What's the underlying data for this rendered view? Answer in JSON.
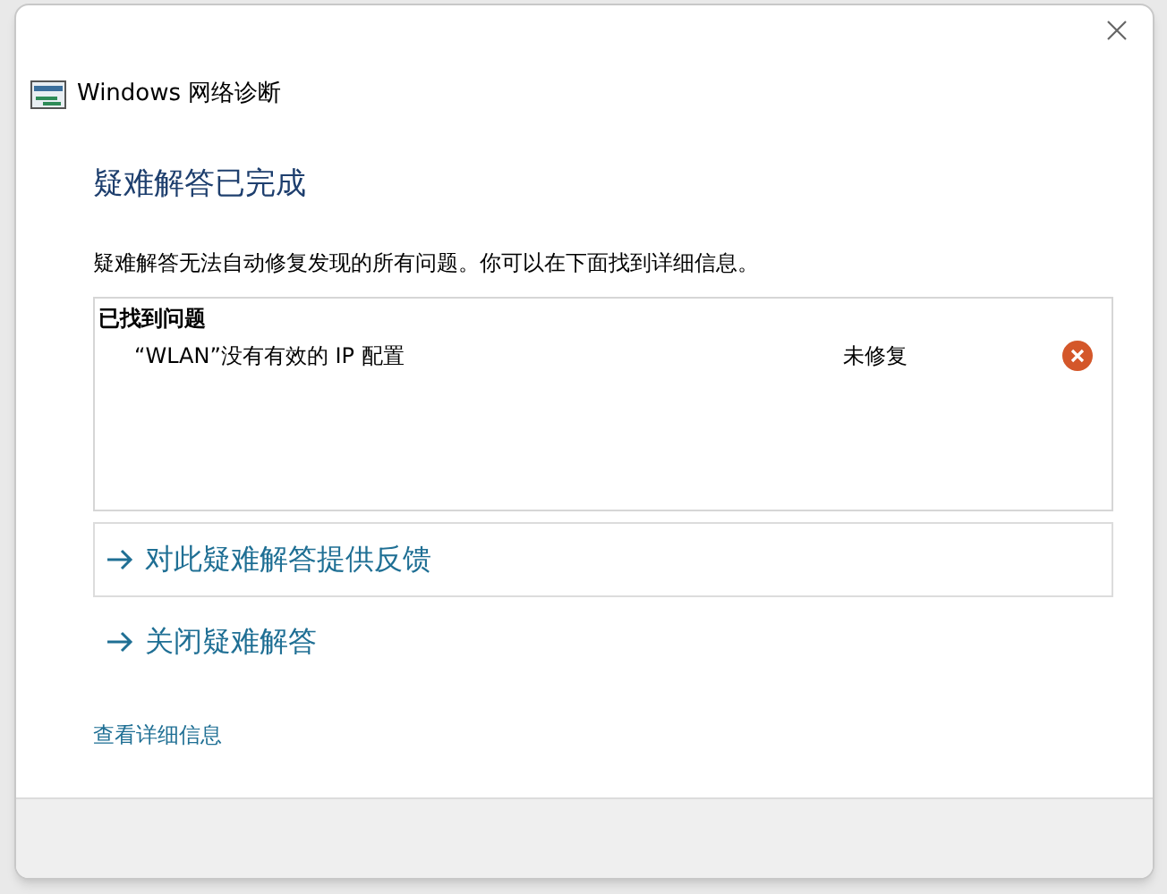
{
  "window": {
    "title": "Windows 网络诊断"
  },
  "heading": "疑难解答已完成",
  "message": "疑难解答无法自动修复发现的所有问题。你可以在下面找到详细信息。",
  "problems": {
    "title": "已找到问题",
    "items": [
      {
        "name": "“WLAN”没有有效的 IP 配置",
        "status": "未修复",
        "kind": "error"
      }
    ]
  },
  "actions": [
    {
      "label": "对此疑难解答提供反馈",
      "bordered": true
    },
    {
      "label": "关闭疑难解答",
      "bordered": false
    }
  ],
  "details_link": "查看详细信息"
}
